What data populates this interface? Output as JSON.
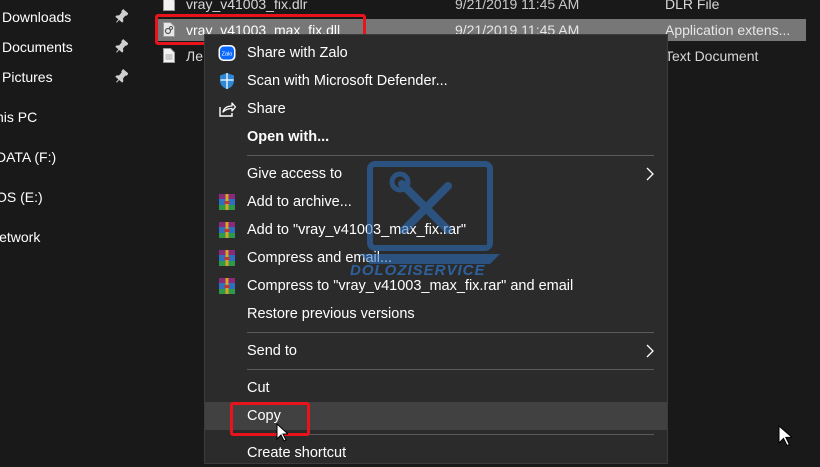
{
  "nav": {
    "items": [
      {
        "label": "Downloads",
        "pinned": true
      },
      {
        "label": "Documents",
        "pinned": true
      },
      {
        "label": "Pictures",
        "pinned": true
      },
      {
        "label": "his PC",
        "pinned": false
      },
      {
        "label": "DATA (F:)",
        "pinned": false
      },
      {
        "label": "OS (E:)",
        "pinned": false
      },
      {
        "label": "letwork",
        "pinned": false
      }
    ]
  },
  "files": {
    "rows": [
      {
        "name": "vray_v41003_fix.dlr",
        "date": "9/21/2019 11:45 AM",
        "type": "DLR File",
        "selected": false
      },
      {
        "name": "vray_v41003_max_fix.dll",
        "date": "9/21/2019 11:45 AM",
        "type": "Application extens...",
        "selected": true
      },
      {
        "name": "Ле",
        "date": "",
        "type": "Text Document",
        "selected": false
      }
    ]
  },
  "menu": {
    "items": [
      {
        "label": "Share with Zalo",
        "icon": "zalo-icon"
      },
      {
        "label": "Scan with Microsoft Defender...",
        "icon": "defender-shield-icon"
      },
      {
        "label": "Share",
        "icon": "share-icon"
      },
      {
        "label": "Open with...",
        "bold": true
      },
      {
        "label": "Give access to",
        "submenu": true
      },
      {
        "label": "Add to archive...",
        "icon": "winrar-icon"
      },
      {
        "label": "Add to \"vray_v41003_max_fix.rar\"",
        "icon": "winrar-icon"
      },
      {
        "label": "Compress and email...",
        "icon": "winrar-icon"
      },
      {
        "label": "Compress to \"vray_v41003_max_fix.rar\" and email",
        "icon": "winrar-icon"
      },
      {
        "label": "Restore previous versions"
      },
      {
        "label": "Send to",
        "submenu": true
      },
      {
        "label": "Cut"
      },
      {
        "label": "Copy",
        "hovered": true
      },
      {
        "label": "Create shortcut"
      }
    ]
  },
  "colors": {
    "background": "#191919",
    "menu_background": "#2b2b2b",
    "selection": "#777777",
    "highlight_red": "#e8131b"
  }
}
